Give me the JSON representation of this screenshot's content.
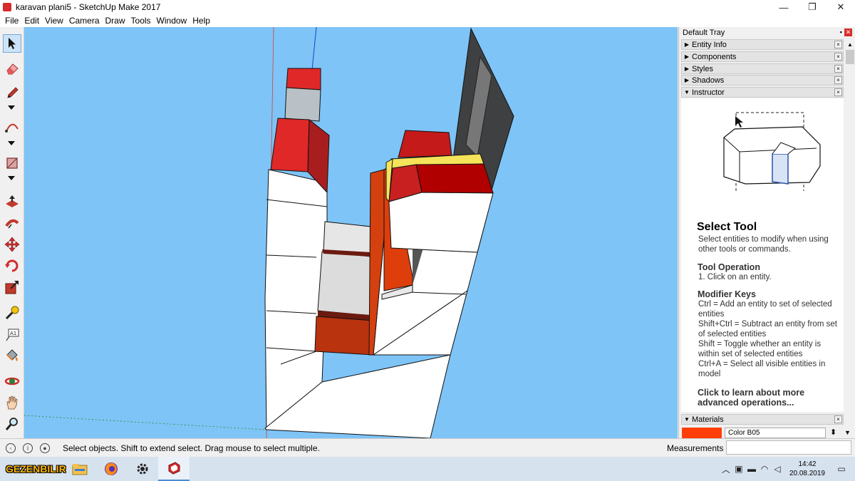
{
  "window": {
    "title": "karavan plani5 - SketchUp Make 2017",
    "minimize": "—",
    "maximize": "❐",
    "close": "✕"
  },
  "menu": [
    "File",
    "Edit",
    "View",
    "Camera",
    "Draw",
    "Tools",
    "Window",
    "Help"
  ],
  "toolbar": {
    "tools": [
      "select-icon",
      "eraser-icon",
      "pencil-icon",
      "arc-icon",
      "rectangle-icon",
      "push-pull-icon",
      "follow-me-icon",
      "move-icon",
      "rotate-icon",
      "scale-icon",
      "tape-measure-icon",
      "text-icon",
      "paint-bucket-icon",
      "orbit-icon",
      "pan-icon",
      "zoom-icon"
    ],
    "text_tool_label": "A1"
  },
  "tray": {
    "title": "Default Tray",
    "pin": "📌",
    "close": "✕",
    "panels": [
      {
        "label": "Entity Info",
        "expanded": false
      },
      {
        "label": "Components",
        "expanded": false
      },
      {
        "label": "Styles",
        "expanded": false
      },
      {
        "label": "Shadows",
        "expanded": false
      },
      {
        "label": "Instructor",
        "expanded": true
      }
    ],
    "panel_close": "×",
    "instructor": {
      "title": "Select Tool",
      "desc": "Select entities to modify when using other tools or commands.",
      "op_head": "Tool Operation",
      "op_text": "1. Click on an entity.",
      "mod_head": "Modifier Keys",
      "mod_lines": [
        "Ctrl = Add an entity to set of selected entities",
        "Shift+Ctrl = Subtract an entity from set of selected entities",
        "Shift = Toggle whether an entity is within set of selected entities",
        "Ctrl+A = Select all visible entities in model"
      ],
      "learn_more": "Click to learn about more advanced operations..."
    },
    "materials": {
      "label": "Materials",
      "color_name": "Color B05",
      "color_hex": "#ff3f0a"
    }
  },
  "status": {
    "message": "Select objects. Shift to extend select. Drag mouse to select multiple.",
    "measurements_label": "Measurements",
    "measurements_value": ""
  },
  "taskbar": {
    "brand": "GEZENBILIR",
    "apps": [
      "file-explorer-icon",
      "firefox-icon",
      "settings-icon",
      "sketchup-icon"
    ],
    "clock_time": "14:42",
    "clock_date": "20.08.2019"
  }
}
